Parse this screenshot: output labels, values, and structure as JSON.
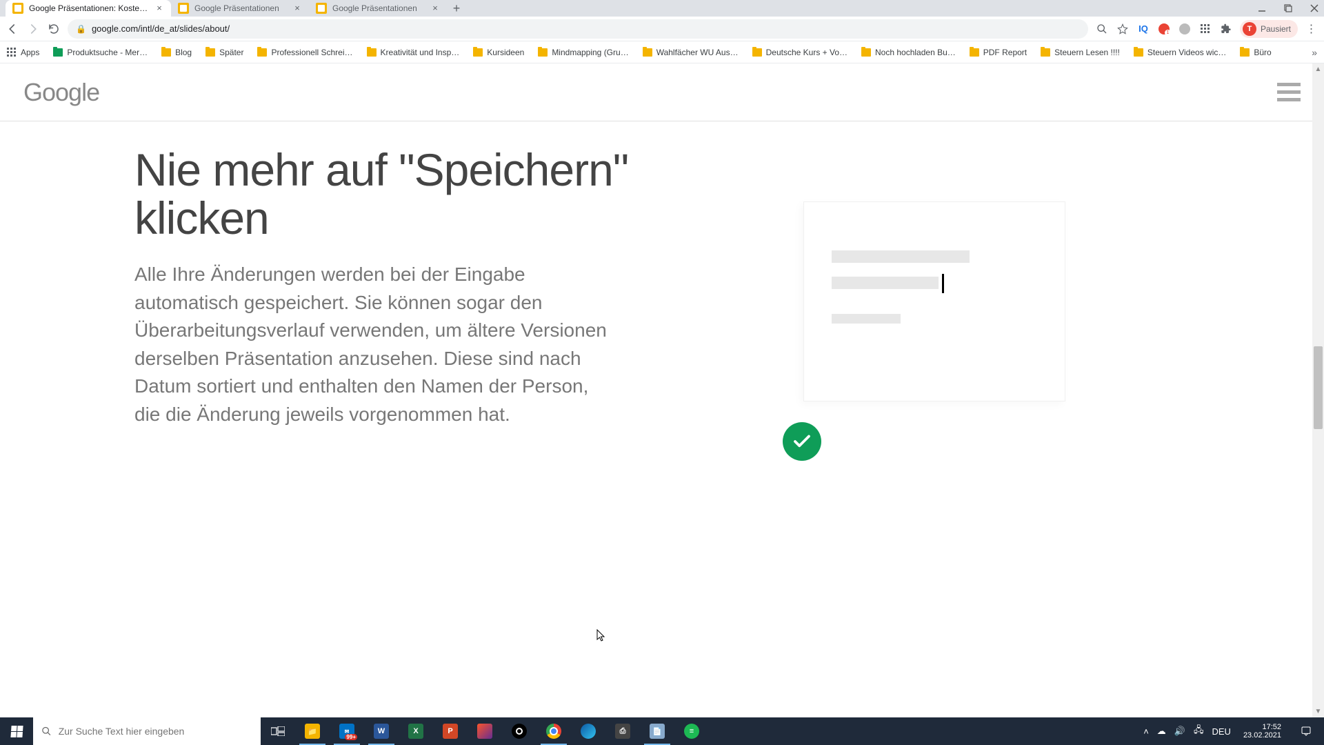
{
  "browser": {
    "tabs": [
      {
        "title": "Google Präsentationen: Kostenlo",
        "active": true
      },
      {
        "title": "Google Präsentationen",
        "active": false
      },
      {
        "title": "Google Präsentationen",
        "active": false
      }
    ],
    "url": "google.com/intl/de_at/slides/about/",
    "profile_status": "Pausiert",
    "profile_initial": "T"
  },
  "bookmarks": {
    "apps_label": "Apps",
    "items": [
      "Produktsuche - Mer…",
      "Blog",
      "Später",
      "Professionell Schrei…",
      "Kreativität und Insp…",
      "Kursideen",
      "Mindmapping  (Gru…",
      "Wahlfächer WU Aus…",
      "Deutsche Kurs + Vo…",
      "Noch hochladen Bu…",
      "PDF Report",
      "Steuern Lesen !!!!",
      "Steuern Videos wic…",
      "Büro"
    ]
  },
  "page": {
    "logo_text": "Google",
    "headline": "Nie mehr auf \"Speichern\" klicken",
    "body": "Alle Ihre Änderungen werden bei der Eingabe automatisch gespeichert. Sie können sogar den Überarbeitungsverlauf verwenden, um ältere Versionen derselben Präsentation anzusehen. Diese sind nach Datum sortiert und enthalten den Namen der Person, die die Änderung jeweils vorgenommen hat."
  },
  "taskbar": {
    "search_placeholder": "Zur Suche Text hier eingeben",
    "lang": "DEU",
    "time": "17:52",
    "date": "23.02.2021",
    "mail_badge": "99+"
  }
}
